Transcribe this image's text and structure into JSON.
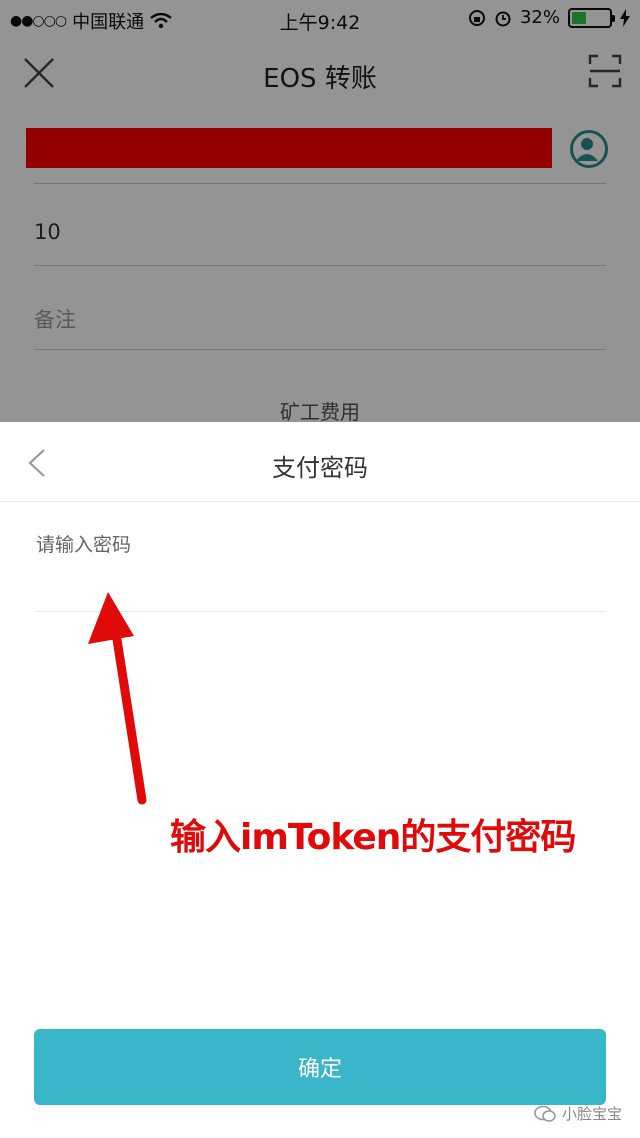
{
  "status_bar": {
    "signal": "●●○○○",
    "carrier": "中国联通",
    "time": "上午9:42",
    "battery_text": "32%",
    "battery_level": 0.32
  },
  "nav": {
    "title": "EOS 转账"
  },
  "form": {
    "amount_value": "10",
    "memo_placeholder": "备注",
    "fee_label": "矿工费用"
  },
  "sheet": {
    "title": "支付密码",
    "password_placeholder": "请输入密码",
    "confirm_label": "确定"
  },
  "annotation": {
    "text": "输入imToken的支付密码",
    "color": "#e00a0a"
  },
  "watermark": {
    "text": "小脸宝宝"
  },
  "colors": {
    "accent": "#39b6c9",
    "redacted": "#ff0000"
  }
}
